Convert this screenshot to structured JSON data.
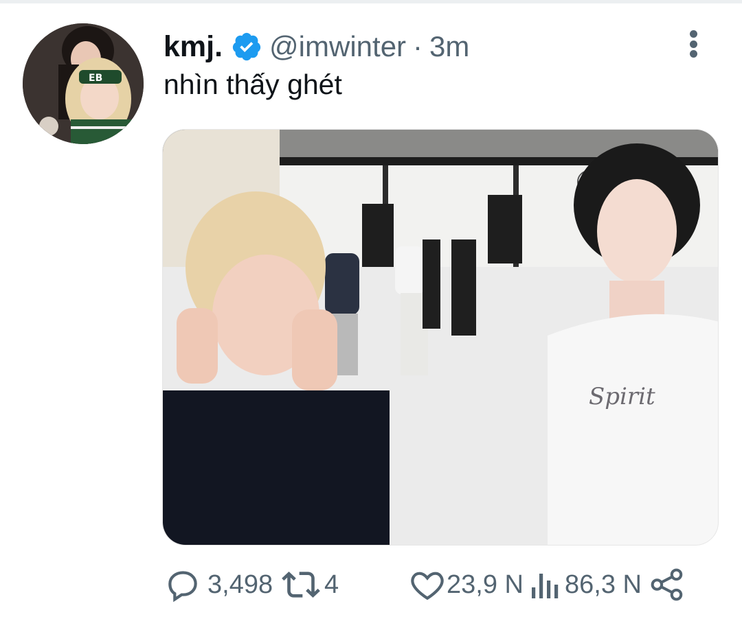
{
  "tweet": {
    "display_name": "kmj.",
    "handle": "@imwinter",
    "separator": "·",
    "time": "3m",
    "text": "nhìn thấy ghét",
    "verified": true,
    "accent_color": "#1d9bf0"
  },
  "actions": {
    "replies": "3,498",
    "retweets": "4",
    "likes": "23,9 N",
    "views": "86,3 N"
  },
  "icons": {
    "more": "more-vertical-icon",
    "reply": "reply-icon",
    "retweet": "retweet-icon",
    "like": "heart-icon",
    "views": "views-icon",
    "share": "share-icon"
  }
}
